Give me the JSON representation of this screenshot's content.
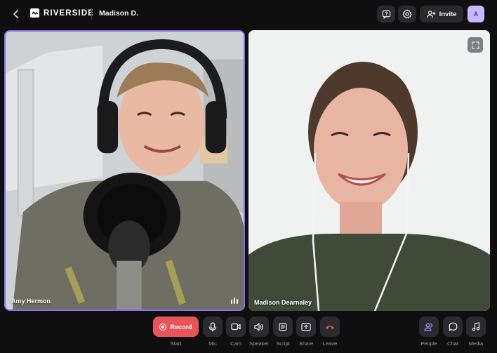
{
  "header": {
    "brand": "RIVERSIDE",
    "session_name": "Madison D.",
    "invite_label": "Invite",
    "avatar_initial": "A"
  },
  "participants": [
    {
      "name": "Amy Hermon",
      "speaking": true
    },
    {
      "name": "Madison Dearnaley",
      "speaking": false
    }
  ],
  "controls": {
    "record_label": "Record",
    "start_label": "Start",
    "mic_label": "Mic",
    "cam_label": "Cam",
    "speaker_label": "Speaker",
    "script_label": "Script",
    "share_label": "Share",
    "leave_label": "Leave",
    "people_label": "People",
    "chat_label": "Chat",
    "media_label": "Media"
  },
  "colors": {
    "accent": "#8b6cf0",
    "record": "#e6555a",
    "leave_icon": "#e6555a",
    "people_icon": "#a98bff",
    "background": "#0f0f10"
  },
  "icons": {
    "back": "chevron-left-icon",
    "help": "message-question-icon",
    "settings": "gear-icon",
    "invite": "add-user-icon",
    "expand": "fullscreen-icon"
  }
}
